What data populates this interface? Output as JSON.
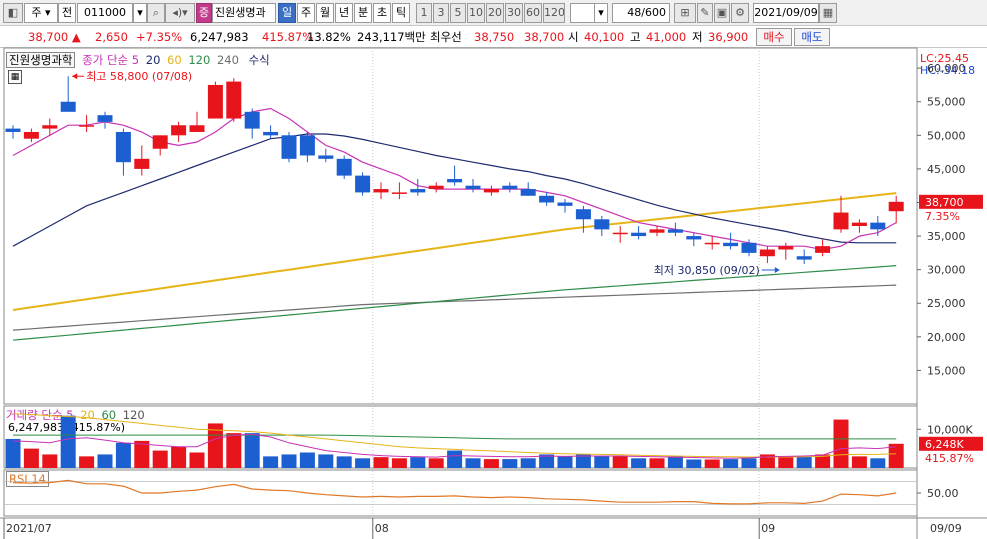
{
  "toolbar": {
    "period_sel": "주",
    "prev_label": "전",
    "code": "011000",
    "stock_name": "진원생명과",
    "name_badge": "증",
    "periods": [
      "일",
      "주",
      "월",
      "년",
      "분",
      "초",
      "틱"
    ],
    "active_period": "일",
    "intervals": [
      "1",
      "3",
      "5",
      "10",
      "20",
      "30",
      "60",
      "120"
    ],
    "count": "48/600",
    "date": "2021/09/09"
  },
  "quote": {
    "price": "38,700",
    "arrow": "▲",
    "change": "2,650",
    "change_pct": "+7.35%",
    "volume": "6,247,983",
    "vol_ratio": "415.87%",
    "turnover": "13.82%",
    "amount": "243,117백만",
    "best_label": "최우선",
    "ask": "38,750",
    "bid": "38,700",
    "open_label": "시",
    "open": "40,100",
    "high_label": "고",
    "high": "41,000",
    "low_label": "저",
    "low": "36,900",
    "buy_label": "매수",
    "sell_label": "매도"
  },
  "legend": {
    "name_tab": "진원생명과학",
    "ma_label": "종가 단순 5",
    "ma_periods": [
      "20",
      "60",
      "120",
      "240"
    ],
    "extra": "수식",
    "lc": "LC:25.45",
    "hc": "HC:-34.18",
    "vol_label": "거래량 단순 5",
    "vol_periods": [
      "20",
      "60",
      "120"
    ],
    "vol_readout": "6,247,983 (415.87%)",
    "rsi_label": "RSI 14"
  },
  "colors": {
    "up": "#e8141c",
    "down": "#1c5fd0",
    "ma5": "#c832b4",
    "ma20": "#1e2a6e",
    "ma60": "#e6b416",
    "ma120": "#2d8c46",
    "ma240": "#6e6e6e",
    "rsi": "#e07828"
  },
  "chart_data": {
    "type": "candlestick",
    "ylim": [
      10000,
      63000
    ],
    "yticks": [
      "60,000",
      "55,000",
      "50,000",
      "45,000",
      "40,000",
      "35,000",
      "30,000",
      "25,000",
      "20,000",
      "15,000"
    ],
    "ytick_values": [
      60000,
      55000,
      50000,
      45000,
      40000,
      35000,
      30000,
      25000,
      20000,
      15000
    ],
    "xticks": [
      {
        "label": "2021/07",
        "index": 0
      },
      {
        "label": "08",
        "index": 20
      },
      {
        "label": "09",
        "index": 41
      }
    ],
    "date_readout": "09/09",
    "annotations": {
      "high": "최고 58,800 (07/08)",
      "high_value": 58800,
      "high_index": 3,
      "low": "최저 30,850 (09/02)",
      "low_value": 30850,
      "low_index": 42
    },
    "last_price_label": "38,700",
    "last_pct_label": "7.35%",
    "candles": [
      [
        51000,
        51500,
        49500,
        50500
      ],
      [
        49500,
        51000,
        49000,
        50500
      ],
      [
        51000,
        52500,
        50000,
        51500
      ],
      [
        55000,
        58800,
        54000,
        53500
      ],
      [
        51500,
        53000,
        50500,
        51500
      ],
      [
        53000,
        53500,
        51000,
        52000
      ],
      [
        50500,
        51000,
        44000,
        46000
      ],
      [
        45000,
        48500,
        44000,
        46500
      ],
      [
        48000,
        50000,
        47000,
        50000
      ],
      [
        50000,
        52000,
        49000,
        51500
      ],
      [
        50500,
        53500,
        50500,
        51500
      ],
      [
        52500,
        58000,
        52500,
        57500
      ],
      [
        52500,
        58500,
        52000,
        58000
      ],
      [
        53500,
        54000,
        49500,
        51000
      ],
      [
        50500,
        51500,
        49500,
        50000
      ],
      [
        50000,
        50500,
        46000,
        46500
      ],
      [
        50000,
        50500,
        46000,
        47000
      ],
      [
        47000,
        48000,
        46000,
        46500
      ],
      [
        46500,
        47000,
        43500,
        44000
      ],
      [
        44000,
        44500,
        41000,
        41500
      ],
      [
        41500,
        43000,
        40500,
        42000
      ],
      [
        41500,
        43000,
        40500,
        41500
      ],
      [
        42000,
        43500,
        41000,
        41500
      ],
      [
        42000,
        43000,
        41500,
        42500
      ],
      [
        43500,
        45500,
        42500,
        43000
      ],
      [
        42500,
        43500,
        41500,
        42000
      ],
      [
        41500,
        42500,
        41000,
        42000
      ],
      [
        42500,
        43000,
        41500,
        42000
      ],
      [
        42000,
        43000,
        41000,
        41000
      ],
      [
        41000,
        41500,
        39500,
        40000
      ],
      [
        40000,
        40500,
        38500,
        39500
      ],
      [
        39000,
        39500,
        35500,
        37500
      ],
      [
        37500,
        38000,
        35000,
        36000
      ],
      [
        35500,
        36500,
        34000,
        35500
      ],
      [
        35500,
        36500,
        34500,
        35000
      ],
      [
        35500,
        36500,
        35000,
        36000
      ],
      [
        36000,
        37000,
        35000,
        35500
      ],
      [
        35000,
        35500,
        33500,
        34500
      ],
      [
        34000,
        35000,
        33000,
        34000
      ],
      [
        34000,
        35500,
        33000,
        33500
      ],
      [
        34000,
        34500,
        32000,
        32500
      ],
      [
        32000,
        33500,
        31000,
        33000
      ],
      [
        33000,
        34000,
        31500,
        33500
      ],
      [
        32000,
        33000,
        30850,
        31500
      ],
      [
        32500,
        34500,
        32000,
        33500
      ],
      [
        36000,
        41000,
        35500,
        38500
      ],
      [
        36500,
        37500,
        35500,
        37000
      ],
      [
        37000,
        38000,
        35000,
        36000
      ],
      [
        38700,
        41000,
        36900,
        40100
      ]
    ],
    "series": [
      {
        "name": "5",
        "values": [
          47000,
          48500,
          50000,
          51500,
          51500,
          52000,
          51500,
          50500,
          49000,
          48500,
          49000,
          50500,
          52500,
          53500,
          54000,
          52500,
          50500,
          48500,
          47500,
          46000,
          45000,
          44000,
          42500,
          42000,
          42000,
          42000,
          42000,
          42000,
          42000,
          41500,
          41000,
          40000,
          39000,
          38000,
          37000,
          36500,
          36000,
          35500,
          35000,
          34500,
          34000,
          33500,
          33500,
          33500,
          33000,
          33500,
          35000,
          35500,
          37000
        ]
      },
      {
        "name": "20",
        "values": [
          33500,
          35000,
          36500,
          38000,
          39500,
          40500,
          41500,
          42500,
          43500,
          44500,
          45500,
          46500,
          47500,
          48500,
          49500,
          49800,
          50200,
          50200,
          49900,
          49400,
          48800,
          48200,
          47600,
          47000,
          46500,
          46000,
          45500,
          45000,
          44600,
          44000,
          43500,
          42800,
          42000,
          41200,
          40400,
          39600,
          38900,
          38300,
          37700,
          37200,
          36700,
          36200,
          35700,
          35100,
          34600,
          34100,
          34000,
          34000,
          34000
        ]
      },
      {
        "name": "60",
        "values": [
          24000,
          24400,
          24800,
          25200,
          25600,
          26000,
          26400,
          26800,
          27200,
          27600,
          28000,
          28400,
          28800,
          29200,
          29600,
          30000,
          30400,
          30800,
          31200,
          31600,
          32000,
          32400,
          32800,
          33200,
          33600,
          34000,
          34400,
          34800,
          35200,
          35600,
          36000,
          36300,
          36600,
          36900,
          37200,
          37500,
          37800,
          38100,
          38400,
          38700,
          39000,
          39300,
          39600,
          39900,
          40200,
          40500,
          40800,
          41100,
          41400
        ]
      },
      {
        "name": "120",
        "values": [
          19500,
          19750,
          20000,
          20250,
          20500,
          20750,
          21000,
          21250,
          21500,
          21750,
          22000,
          22250,
          22500,
          22750,
          23000,
          23250,
          23500,
          23750,
          24000,
          24250,
          24500,
          24750,
          25000,
          25250,
          25500,
          25750,
          26000,
          26250,
          26500,
          26750,
          27000,
          27200,
          27400,
          27600,
          27800,
          28000,
          28200,
          28400,
          28600,
          28800,
          29000,
          29200,
          29400,
          29600,
          29800,
          30000,
          30200,
          30400,
          30600
        ]
      },
      {
        "name": "240",
        "values": [
          21000,
          21200,
          21400,
          21600,
          21800,
          22000,
          22200,
          22400,
          22600,
          22800,
          23000,
          23200,
          23400,
          23600,
          23800,
          24000,
          24200,
          24400,
          24600,
          24800,
          24900,
          25000,
          25100,
          25200,
          25300,
          25400,
          25500,
          25600,
          25700,
          25800,
          25900,
          26000,
          26100,
          26200,
          26300,
          26400,
          26500,
          26600,
          26700,
          26800,
          26900,
          27000,
          27100,
          27200,
          27300,
          27400,
          27500,
          27600,
          27700
        ]
      }
    ],
    "volume": {
      "ylim": [
        0,
        16000000
      ],
      "yticks": [
        "10,000K"
      ],
      "ytick_values": [
        10000000
      ],
      "last_label": "6,248K",
      "last_pct": "415.87%",
      "values": [
        7500000,
        5000000,
        3500000,
        13500000,
        3000000,
        3500000,
        6500000,
        7000000,
        4500000,
        5500000,
        4000000,
        11500000,
        9000000,
        9000000,
        3000000,
        3500000,
        4000000,
        3500000,
        3000000,
        2500000,
        2800000,
        2500000,
        2800000,
        2500000,
        4500000,
        2500000,
        2300000,
        2300000,
        2500000,
        3500000,
        3000000,
        3500000,
        3000000,
        3000000,
        2500000,
        2500000,
        3000000,
        2200000,
        2200000,
        2300000,
        2500000,
        3500000,
        2800000,
        3000000,
        3500000,
        12500000,
        3000000,
        2500000,
        6248000
      ],
      "ma5": [
        7000000,
        6800000,
        6500000,
        7500000,
        7800000,
        7200000,
        6500000,
        6200000,
        5800000,
        5500000,
        5500000,
        7500000,
        8500000,
        8700000,
        8000000,
        6500000,
        5500000,
        4500000,
        4000000,
        3500000,
        3200000,
        3000000,
        2900000,
        2800000,
        3200000,
        3100000,
        3000000,
        2900000,
        2900000,
        3100000,
        3000000,
        3100000,
        3100000,
        3100000,
        3000000,
        2900000,
        2800000,
        2700000,
        2600000,
        2500000,
        2600000,
        2900000,
        3000000,
        3100000,
        3300000,
        5000000,
        5200000,
        5000000,
        5500000
      ],
      "ma20": [
        14000000,
        13800000,
        13500000,
        13300000,
        13000000,
        12500000,
        12000000,
        11500000,
        11000000,
        10500000,
        10000000,
        9800000,
        9600000,
        9400000,
        9000000,
        8500000,
        8000000,
        7500000,
        7000000,
        6500000,
        6000000,
        5500000,
        5200000,
        5000000,
        4800000,
        4600000,
        4400000,
        4200000,
        4000000,
        3800000,
        3700000,
        3600000,
        3500000,
        3400000,
        3300000,
        3200000,
        3100000,
        3000000,
        2950000,
        2900000,
        2850000,
        2850000,
        2850000,
        2900000,
        3000000,
        3400000,
        3500000,
        3500000,
        3700000
      ],
      "ma60": [
        8500000,
        8500000,
        8500000,
        8500000,
        8500000,
        8500000,
        8500000,
        8500000,
        8500000,
        8500000,
        8500000,
        8500000,
        8500000,
        8500000,
        8500000,
        8500000,
        8500000,
        8500000,
        8400000,
        8300000,
        8200000,
        8100000,
        8000000,
        7900000,
        7800000,
        7700000,
        7600000,
        7500000,
        7500000,
        7500000,
        7500000,
        7500000,
        7500000,
        7500000,
        7500000,
        7500000,
        7500000,
        7500000,
        7500000,
        7500000,
        7500000,
        7500000,
        7500000,
        7500000,
        7500000,
        7500000,
        7500000,
        7500000,
        7500000
      ]
    },
    "rsi": {
      "ylim": [
        10,
        90
      ],
      "yticks": [
        "50.00"
      ],
      "ytick_values": [
        50
      ],
      "values": [
        68,
        67,
        68,
        72,
        66,
        66,
        62,
        50,
        50,
        53,
        55,
        61,
        65,
        57,
        55,
        54,
        50,
        47,
        45,
        43,
        44,
        43,
        44,
        44,
        45,
        43,
        42,
        43,
        42,
        40,
        39,
        38,
        36,
        34,
        34,
        34,
        35,
        35,
        32,
        31,
        31,
        33,
        33,
        32,
        36,
        48,
        47,
        45,
        50
      ]
    }
  }
}
